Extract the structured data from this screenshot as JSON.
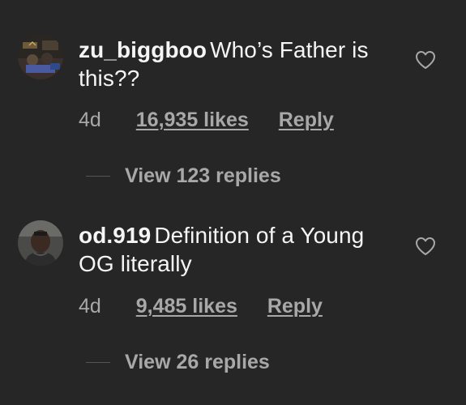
{
  "comments": [
    {
      "username": "zu_biggboo",
      "text": "Who’s Father is this??",
      "time": "4d",
      "likes": "16,935 likes",
      "reply": "Reply",
      "view_replies": "View 123 replies"
    },
    {
      "username": "od.919",
      "text": "Definition of a Young OG literally",
      "time": "4d",
      "likes": "9,485 likes",
      "reply": "Reply",
      "view_replies": "View 26 replies"
    }
  ],
  "icons": {
    "like": "heart-outline-icon"
  },
  "colors": {
    "background": "#262626",
    "primary_text": "#f5f5f5",
    "secondary_text": "#a8a8a8"
  }
}
